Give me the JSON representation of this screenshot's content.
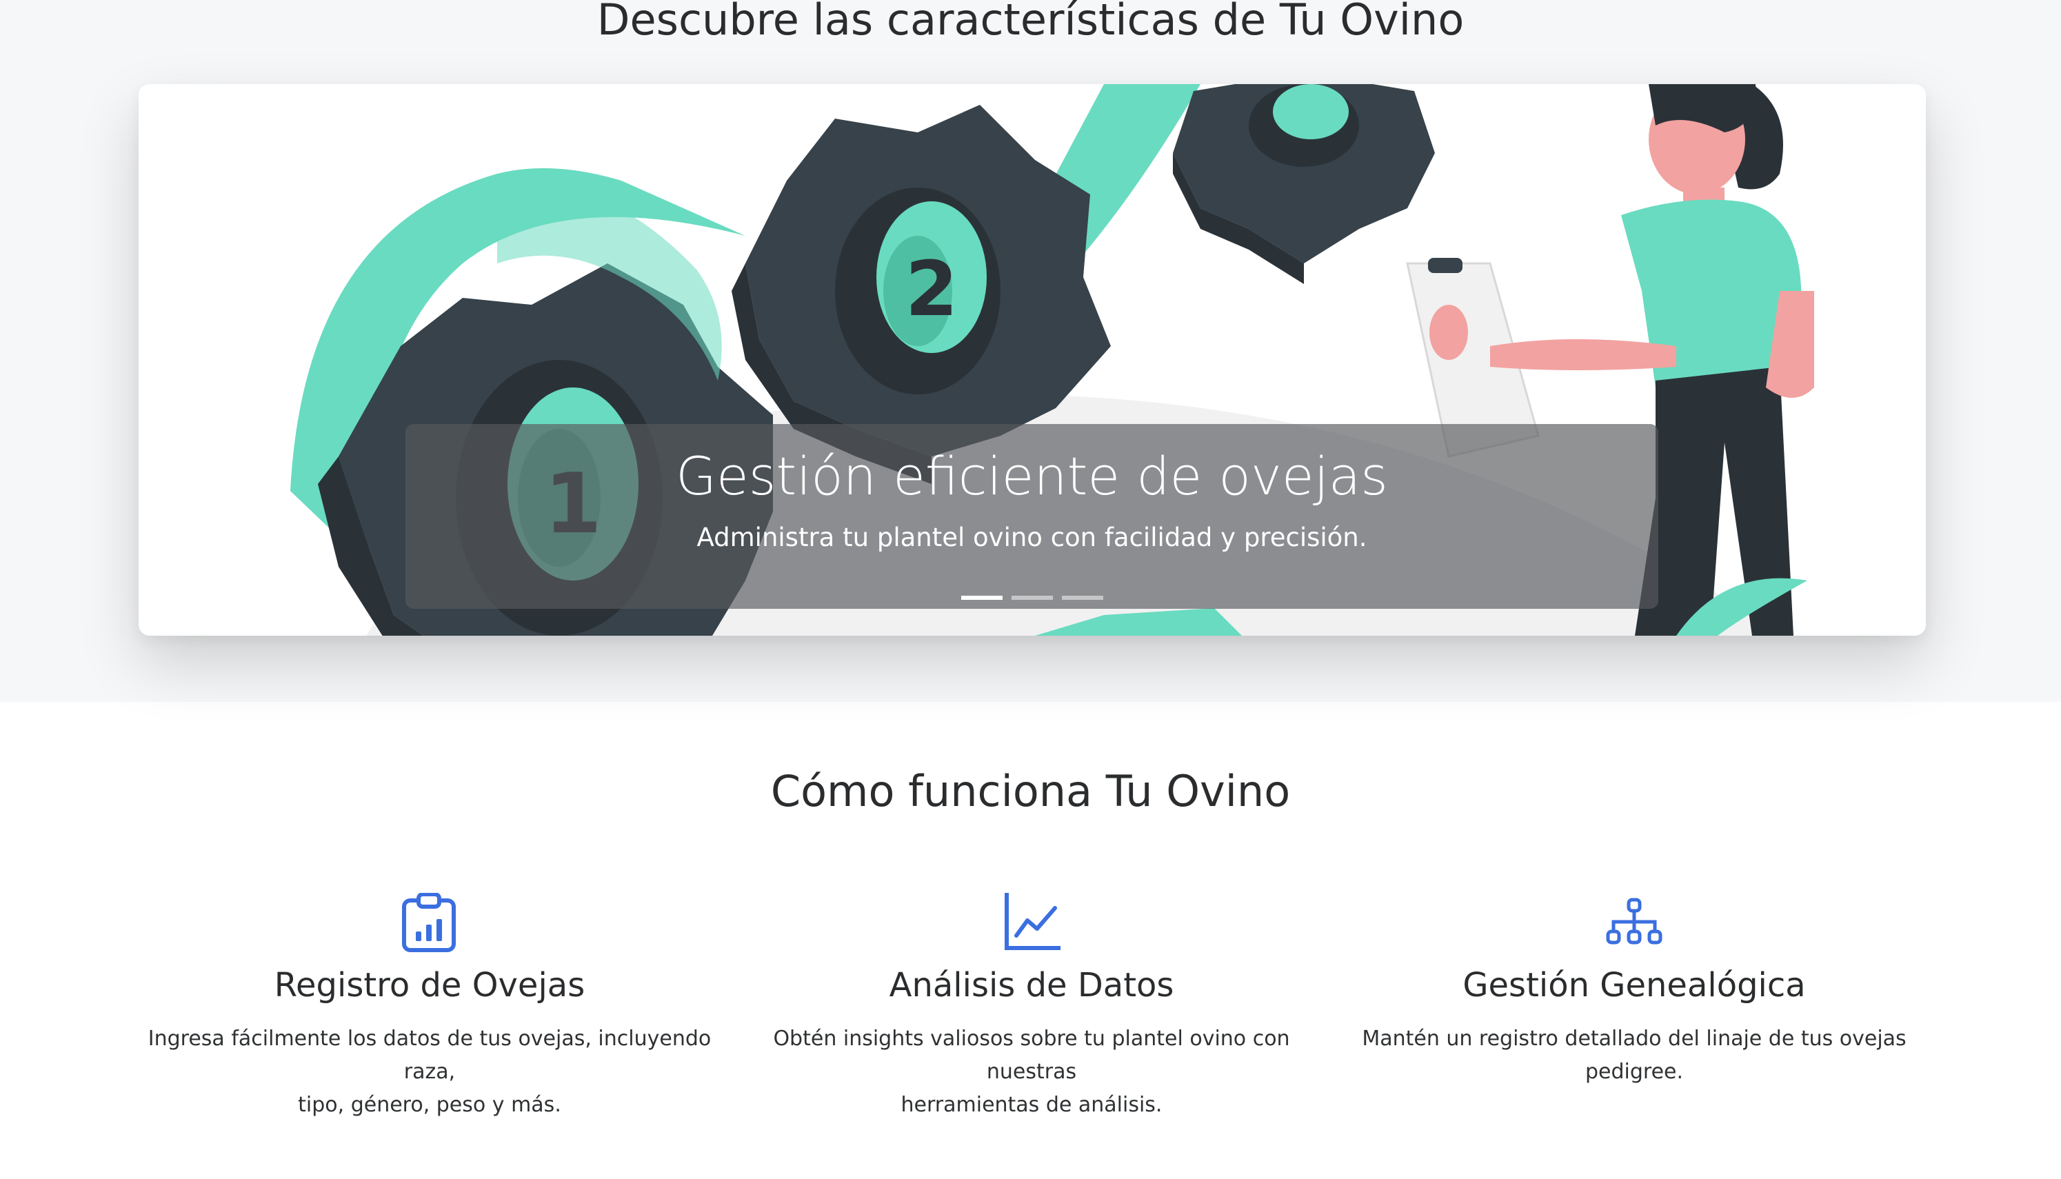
{
  "features_section": {
    "title": "Descubre las características de Tu Ovino",
    "carousel": {
      "slide": {
        "title": "Gestión eficiente de ovejas",
        "text": "Administra tu plantel ovino con facilidad y precisión."
      },
      "indicators": [
        {
          "active": true
        },
        {
          "active": false
        },
        {
          "active": false
        }
      ]
    }
  },
  "how_section": {
    "title": "Cómo funciona Tu Ovino",
    "items": [
      {
        "icon": "clipboard-chart-icon",
        "title": "Registro de Ovejas",
        "text_line1": "Ingresa fácilmente los datos de tus ovejas, incluyendo raza,",
        "text_line2": "tipo, género, peso y más."
      },
      {
        "icon": "line-chart-icon",
        "title": "Análisis de Datos",
        "text_line1": "Obtén insights valiosos sobre tu plantel ovino con nuestras",
        "text_line2": "herramientas de análisis."
      },
      {
        "icon": "org-chart-icon",
        "title": "Gestión Genealógica",
        "text_line1": "Mantén un registro detallado del linaje de tus ovejas",
        "text_line2": "pedigree."
      }
    ]
  },
  "colors": {
    "accent": "#3b6fe0",
    "mint": "#69dbc0",
    "gear_dark": "#37424a",
    "page_top_bg": "#f6f7f9"
  }
}
